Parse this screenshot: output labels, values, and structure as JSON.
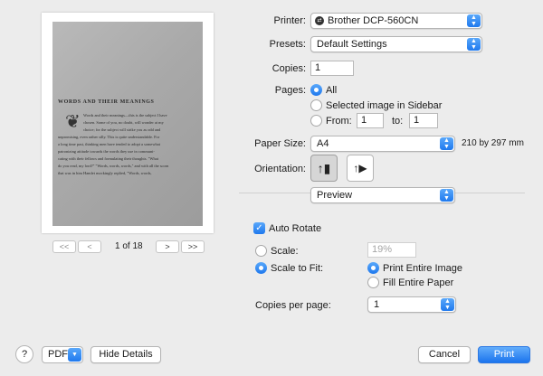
{
  "printer": {
    "label": "Printer:",
    "value": "Brother DCP-560CN"
  },
  "presets": {
    "label": "Presets:",
    "value": "Default Settings"
  },
  "copies": {
    "label": "Copies:",
    "value": "1"
  },
  "pages": {
    "label": "Pages:",
    "all": "All",
    "selected": "Selected image in Sidebar",
    "from_label": "From:",
    "from_value": "1",
    "to_label": "to:",
    "to_value": "1"
  },
  "paper_size": {
    "label": "Paper Size:",
    "value": "A4",
    "dimensions": "210 by 297 mm"
  },
  "orientation": {
    "label": "Orientation:"
  },
  "section": {
    "value": "Preview"
  },
  "preview_opts": {
    "auto_rotate": "Auto Rotate",
    "scale_label": "Scale:",
    "scale_value": "19%",
    "scale_to_fit": "Scale to Fit:",
    "print_entire": "Print Entire Image",
    "fill_entire": "Fill Entire Paper",
    "copies_per_page_label": "Copies per page:",
    "copies_per_page_value": "1"
  },
  "page_nav": {
    "first": "<<",
    "prev": "<",
    "next": ">",
    "last": ">>",
    "indicator": "1 of 18"
  },
  "document": {
    "heading": "WORDS AND THEIR MEANINGS",
    "lines": [
      "Words and their meanings—this is the subject I have",
      "chosen. Some of you, no doubt, will wonder at my",
      "choice; for the subject will strike you as odd and",
      "unpromising, even rather silly. This is quite understandable. For",
      "a long time past, thinking men have tended to adopt a somewhat",
      "patronizing attitude towards the words they use in communi-",
      "cating with their fellows and formulating their thoughts. \"What",
      "do you read, my lord?\" \"Words, words, words,\" and with all the scorn",
      "that was in him Hamlet mockingly replied, \"Words, words,"
    ]
  },
  "footer": {
    "help": "?",
    "pdf": "PDF",
    "hide_details": "Hide Details",
    "cancel": "Cancel",
    "print": "Print"
  },
  "colors": {
    "accent": "#1f79ee"
  }
}
